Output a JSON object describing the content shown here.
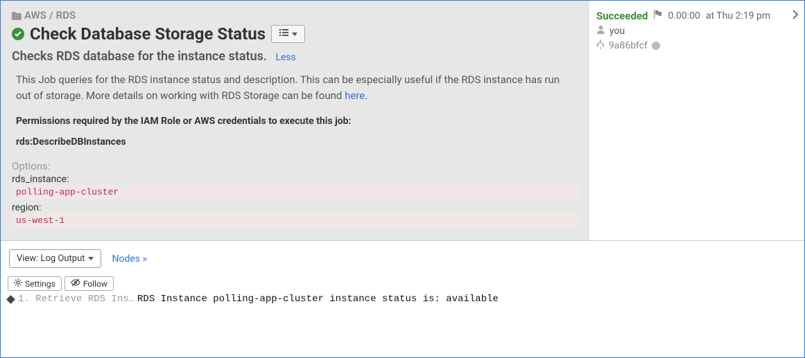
{
  "breadcrumb": {
    "parent": "AWS",
    "sep": "/",
    "child": "RDS"
  },
  "title": "Check Database Storage Status",
  "subtitle": "Checks RDS database for the instance status.",
  "less_label": "Less",
  "description": {
    "text_pre": "This Job queries for the RDS instance status and description. This can be especially useful if the RDS instance has run out of storage. More details on working with RDS Storage can be found ",
    "link_text": "here",
    "text_post": "."
  },
  "permissions": {
    "heading": "Permissions required by the IAM Role or AWS credentials to execute this job:",
    "items": [
      "rds:DescribeDBInstances"
    ]
  },
  "options": {
    "label": "Options:",
    "entries": [
      {
        "key": "rds_instance:",
        "value": "polling-app-cluster"
      },
      {
        "key": "region:",
        "value": "us-west-1"
      }
    ]
  },
  "side": {
    "status": "Succeeded",
    "duration": "0.00:00",
    "timestamp": "at Thu 2:19 pm",
    "user": "you",
    "commit": "9a86bfcf"
  },
  "view": {
    "button_label": "View: Log Output",
    "nodes_link": "Nodes »"
  },
  "toolbar": {
    "settings": "Settings",
    "follow": "Follow"
  },
  "log": {
    "step": "1. Retrieve RDS Ins…",
    "message": "RDS Instance polling-app-cluster instance status is: available"
  }
}
